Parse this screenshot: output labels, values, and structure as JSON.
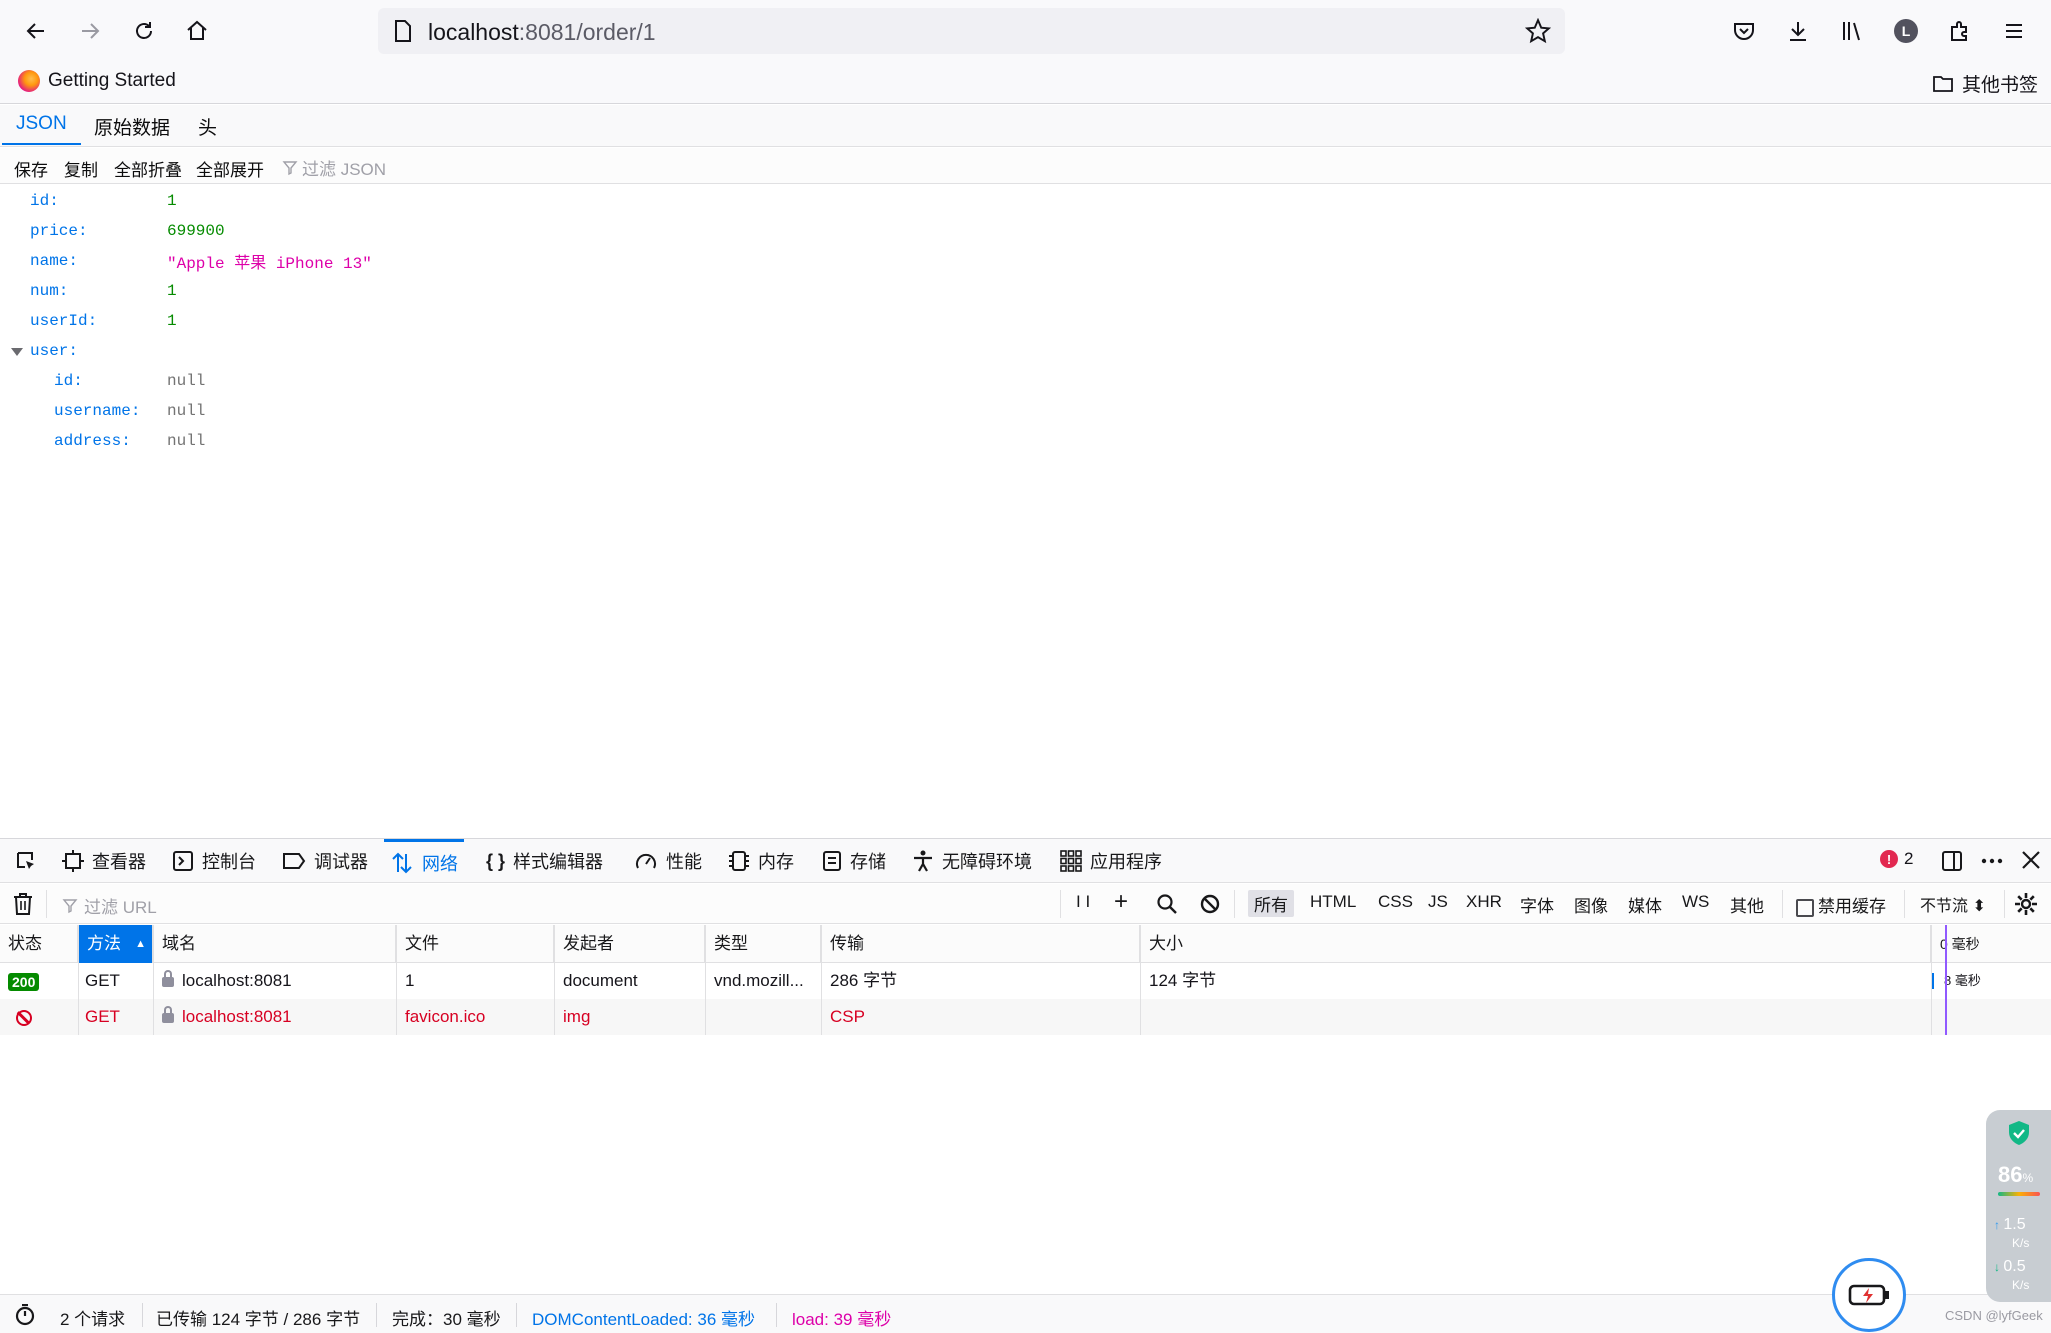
{
  "browser": {
    "url_host": "localhost",
    "url_rest": ":8081/order/1",
    "bookmarks": {
      "first": "Getting Started",
      "other": "其他书签"
    },
    "avatar_letter": "L"
  },
  "json_viewer": {
    "tabs": [
      "JSON",
      "原始数据",
      "头"
    ],
    "toolbar": {
      "save": "保存",
      "copy": "复制",
      "collapse_all": "全部折叠",
      "expand_all": "全部展开",
      "filter_placeholder": "过滤 JSON"
    },
    "rows": [
      {
        "key": "id:",
        "value": "1",
        "type": "number"
      },
      {
        "key": "price:",
        "value": "699900",
        "type": "number"
      },
      {
        "key": "name:",
        "value": "\"Apple 苹果 iPhone 13\"",
        "type": "string"
      },
      {
        "key": "num:",
        "value": "1",
        "type": "number"
      },
      {
        "key": "userId:",
        "value": "1",
        "type": "number"
      },
      {
        "key": "user:",
        "value": "",
        "type": "object"
      },
      {
        "key": "id:",
        "value": "null",
        "type": "null"
      },
      {
        "key": "username:",
        "value": "null",
        "type": "null"
      },
      {
        "key": "address:",
        "value": "null",
        "type": "null"
      }
    ]
  },
  "devtools": {
    "tabs": [
      "查看器",
      "控制台",
      "调试器",
      "网络",
      "样式编辑器",
      "性能",
      "内存",
      "存储",
      "无障碍环境",
      "应用程序"
    ],
    "error_count": "2",
    "filter_placeholder": "过滤 URL",
    "pause_glyph": "I I",
    "type_filters": [
      "所有",
      "HTML",
      "CSS",
      "JS",
      "XHR",
      "字体",
      "图像",
      "媒体",
      "WS",
      "其他"
    ],
    "disable_cache": "禁用缓存",
    "throttle": "不节流 ⬍",
    "columns": [
      "状态",
      "方法",
      "域名",
      "文件",
      "发起者",
      "类型",
      "传输",
      "大小"
    ],
    "waterfall_label": "0 毫秒",
    "requests": [
      {
        "status": "200",
        "method": "GET",
        "domain": "localhost:8081",
        "file": "1",
        "initiator": "document",
        "type": "vnd.mozill...",
        "transfer": "286 字节",
        "size": "124 字节",
        "timing": "8 毫秒"
      },
      {
        "status": "",
        "method": "GET",
        "domain": "localhost:8081",
        "file": "favicon.ico",
        "initiator": "img",
        "type": "",
        "transfer": "CSP",
        "size": "",
        "timing": ""
      }
    ],
    "status_bar": {
      "requests": "2 个请求",
      "transferred": "已传输 124 字节 / 286 字节",
      "finish": "完成：30 毫秒",
      "dom_loaded": "DOMContentLoaded: 36 毫秒",
      "load": "load: 39 毫秒"
    }
  },
  "widgets": {
    "percent": "86",
    "percent_unit": "%",
    "up_speed": "1.5",
    "down_speed": "0.5",
    "speed_unit": "K/s"
  },
  "watermark": "CSDN @lyfGeek",
  "colors": {
    "accent": "#0074e8",
    "json_number": "#058b00",
    "json_string": "#dd00a9",
    "error": "#d70022"
  }
}
